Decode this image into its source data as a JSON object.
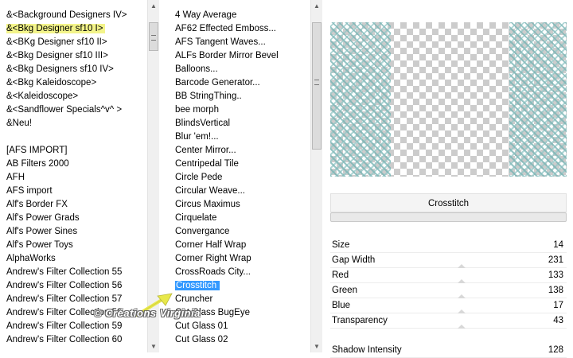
{
  "categories": {
    "items": [
      "&<Background Designers IV>",
      "&<Bkg Designer sf10 I>",
      "&<BKg Designer sf10 II>",
      "&<Bkg Designer sf10 III>",
      "&<Bkg Designers sf10 IV>",
      "&<Bkg Kaleidoscope>",
      "&<Kaleidoscope>",
      "&<Sandflower Specials^v^ >",
      "&Neu!",
      "",
      "[AFS IMPORT]",
      "AB Filters 2000",
      "AFH",
      "AFS import",
      "Alf's Border FX",
      "Alf's Power Grads",
      "Alf's Power Sines",
      "Alf's Power Toys",
      "AlphaWorks",
      "Andrew's Filter Collection 55",
      "Andrew's Filter Collection 56",
      "Andrew's Filter Collection 57",
      "Andrew's Filter Collection 58",
      "Andrew's Filter Collection 59",
      "Andrew's Filter Collection 60"
    ],
    "selected_index": 1,
    "highlight_color": "#f3f48a"
  },
  "filters": {
    "items": [
      "4 Way Average",
      "AF62 Effected Emboss...",
      "AFS Tangent Waves...",
      "ALFs Border Mirror Bevel",
      "Balloons...",
      "Barcode Generator...",
      "BB StringThing..",
      "bee morph",
      "BlindsVertical",
      "Blur 'em!...",
      "Center Mirror...",
      "Centripedal Tile",
      "Circle Pede",
      "Circular Weave...",
      "Circus Maximus",
      "Cirquelate",
      "Convergance",
      "Corner Half Wrap",
      "Corner Right Wrap",
      "CrossRoads City...",
      "Crosstitch",
      "Cruncher",
      "Cut Glass  BugEye",
      "Cut Glass 01",
      "Cut Glass 02"
    ],
    "selected_index": 20,
    "selection_color": "#3399ff"
  },
  "preview": {
    "name": "Crosstitch",
    "pattern_color": "#78b4b4"
  },
  "controls": [
    {
      "label": "Size",
      "value": "14"
    },
    {
      "label": "Gap Width",
      "value": "231"
    },
    {
      "label": "Red",
      "value": "133"
    },
    {
      "label": "Green",
      "value": "138"
    },
    {
      "label": "Blue",
      "value": "17"
    },
    {
      "label": "Transparency",
      "value": "43"
    },
    {
      "label": "",
      "value": ""
    },
    {
      "label": "Shadow Intensity",
      "value": "128"
    }
  ],
  "watermark": "© Créations Virginia",
  "arrow_color": "#e8e84a"
}
